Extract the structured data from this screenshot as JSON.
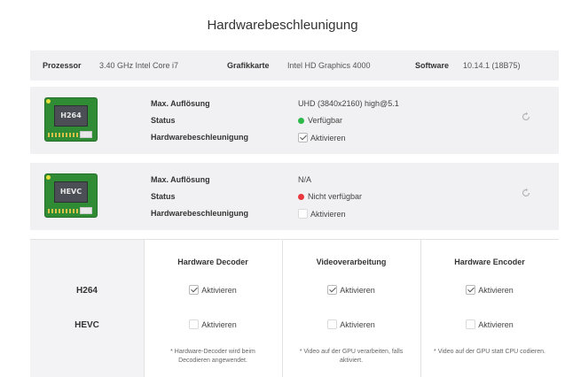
{
  "title": "Hardwarebeschleunigung",
  "info": {
    "processor_label": "Prozessor",
    "processor_value": "3.40 GHz Intel Core i7",
    "graphics_label": "Grafikkarte",
    "graphics_value": "Intel HD Graphics 4000",
    "software_label": "Software",
    "software_value": "10.14.1 (18B75)"
  },
  "codecs": [
    {
      "chip_label": "H264",
      "max_res_label": "Max. Auflösung",
      "max_res_value": "UHD (3840x2160) high@5.1",
      "status_label": "Status",
      "status_value": "Verfügbar",
      "status_color": "#2db84a",
      "accel_label": "Hardwarebeschleunigung",
      "accel_checkbox_label": "Aktivieren",
      "accel_checked": true,
      "accel_enabled": true
    },
    {
      "chip_label": "HEVC",
      "max_res_label": "Max. Auflösung",
      "max_res_value": "N/A",
      "status_label": "Status",
      "status_value": "Nicht verfügbar",
      "status_color": "#e8383d",
      "accel_label": "Hardwarebeschleunigung",
      "accel_checkbox_label": "Aktivieren",
      "accel_checked": false,
      "accel_enabled": false
    }
  ],
  "matrix": {
    "columns": [
      "Hardware Decoder",
      "Videoverarbeitung",
      "Hardware Encoder"
    ],
    "rows": [
      {
        "label": "H264",
        "cells": [
          "Aktivieren",
          "Aktivieren",
          "Aktivieren"
        ],
        "checked": [
          true,
          true,
          true
        ],
        "enabled": [
          true,
          true,
          true
        ]
      },
      {
        "label": "HEVC",
        "cells": [
          "Aktivieren",
          "Aktivieren",
          "Aktivieren"
        ],
        "checked": [
          false,
          false,
          false
        ],
        "enabled": [
          false,
          false,
          false
        ]
      }
    ],
    "notes": [
      "* Hardware-Decoder wird beim Decodieren angewendet.",
      "* Video auf der GPU verarbeiten, falls aktiviert.",
      "* Video auf der GPU statt CPU codieren."
    ]
  },
  "icons": {
    "refresh": "refresh-icon",
    "chip": "gpu-chip-icon"
  }
}
